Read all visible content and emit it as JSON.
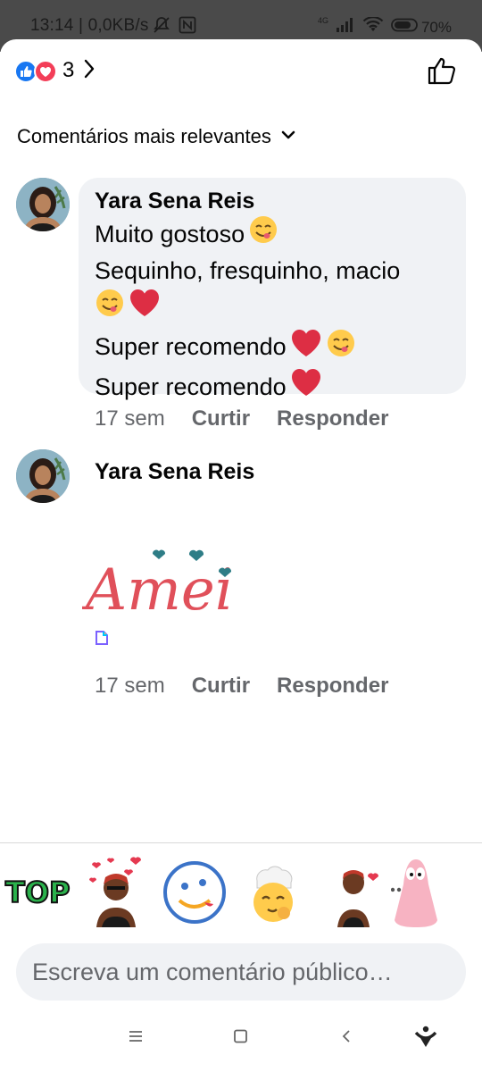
{
  "status_bar": {
    "time_data": "13:14 | 0,0KB/s",
    "network": "4G",
    "battery": "70%",
    "icons": [
      "mute-bell-icon",
      "nfc-icon",
      "signal-icon",
      "wifi-icon",
      "battery-icon"
    ]
  },
  "reactions": {
    "count": "3",
    "icons": [
      "like-reaction-icon",
      "love-reaction-icon"
    ],
    "colors": {
      "like": "#1877f2",
      "love": "#f33e58"
    }
  },
  "sort": {
    "label": "Comentários mais relevantes"
  },
  "comments": [
    {
      "author": "Yara Sena Reis",
      "lines": [
        "Muito gostoso",
        "Sequinho, fresquinho, macio",
        "",
        "Super recomendo",
        "Super recomendo"
      ],
      "time": "17 sem",
      "like_label": "Curtir",
      "reply_label": "Responder"
    },
    {
      "author": "Yara Sena Reis",
      "sticker_text": "Amei",
      "time": "17 sem",
      "like_label": "Curtir",
      "reply_label": "Responder"
    }
  ],
  "sticker_bar": {
    "items": [
      "TOP",
      "bitmoji-hearts-sticker",
      "yum-face-sticker",
      "chef-sticker",
      "bitmoji-heart-sticker",
      "patrick-sticker"
    ]
  },
  "composer": {
    "placeholder": "Escreva um comentário público…"
  },
  "nav": {
    "items": [
      "menu-icon",
      "home-icon",
      "back-icon",
      "assistant-icon"
    ]
  }
}
